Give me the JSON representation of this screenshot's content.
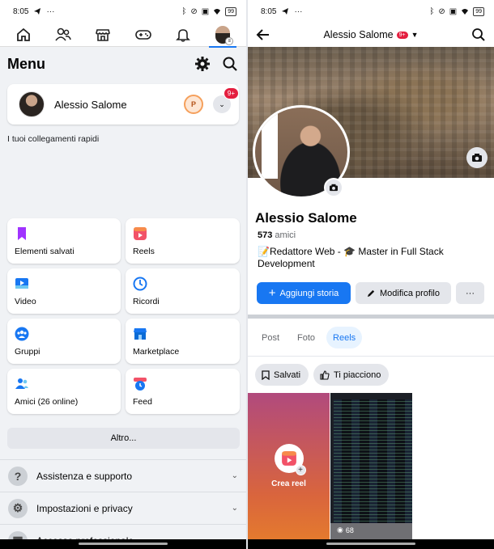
{
  "status": {
    "time": "8:05",
    "battery": "99"
  },
  "menu": {
    "title": "Menu",
    "profile_name": "Alessio Salome",
    "profile_badge": "P",
    "notif_count": "9+",
    "shortcuts_label": "I tuoi collegamenti rapidi",
    "tiles": [
      {
        "label": "Elementi salvati",
        "icon": "bookmark-icon",
        "color": "#a033ff"
      },
      {
        "label": "Reels",
        "icon": "reels-icon",
        "color": "#f25268"
      },
      {
        "label": "Video",
        "icon": "video-icon",
        "color": "#1877f2"
      },
      {
        "label": "Ricordi",
        "icon": "memories-clock-icon",
        "color": "#1877f2"
      },
      {
        "label": "Gruppi",
        "icon": "groups-icon",
        "color": "#1877f2"
      },
      {
        "label": "Marketplace",
        "icon": "marketplace-icon",
        "color": "#1877f2"
      },
      {
        "label": "Amici (26 online)",
        "icon": "friends-icon",
        "color": "#1877f2"
      },
      {
        "label": "Feed",
        "icon": "feed-icon",
        "color": "#1877f2"
      }
    ],
    "more_label": "Altro...",
    "sections": [
      {
        "label": "Assistenza e supporto",
        "icon": "help-icon"
      },
      {
        "label": "Impostazioni e privacy",
        "icon": "settings-icon"
      },
      {
        "label": "Accesso professionale",
        "icon": "professional-icon"
      }
    ]
  },
  "profile": {
    "header_name": "Alessio Salome",
    "header_badge": "9+",
    "name": "Alessio Salome",
    "friends_count": "573",
    "friends_label": "amici",
    "bio": "📝Redattore Web - 🎓 Master in Full Stack Development",
    "add_story_label": "Aggiungi storia",
    "edit_profile_label": "Modifica profilo",
    "more_label": "···",
    "tabs": [
      "Post",
      "Foto",
      "Reels"
    ],
    "active_tab": "Reels",
    "chips": [
      "Salvati",
      "Ti piacciono"
    ],
    "create_reel_label": "Crea reel",
    "reel_views": "68"
  },
  "colors": {
    "brand": "#1877f2",
    "notif": "#e41e3f"
  }
}
